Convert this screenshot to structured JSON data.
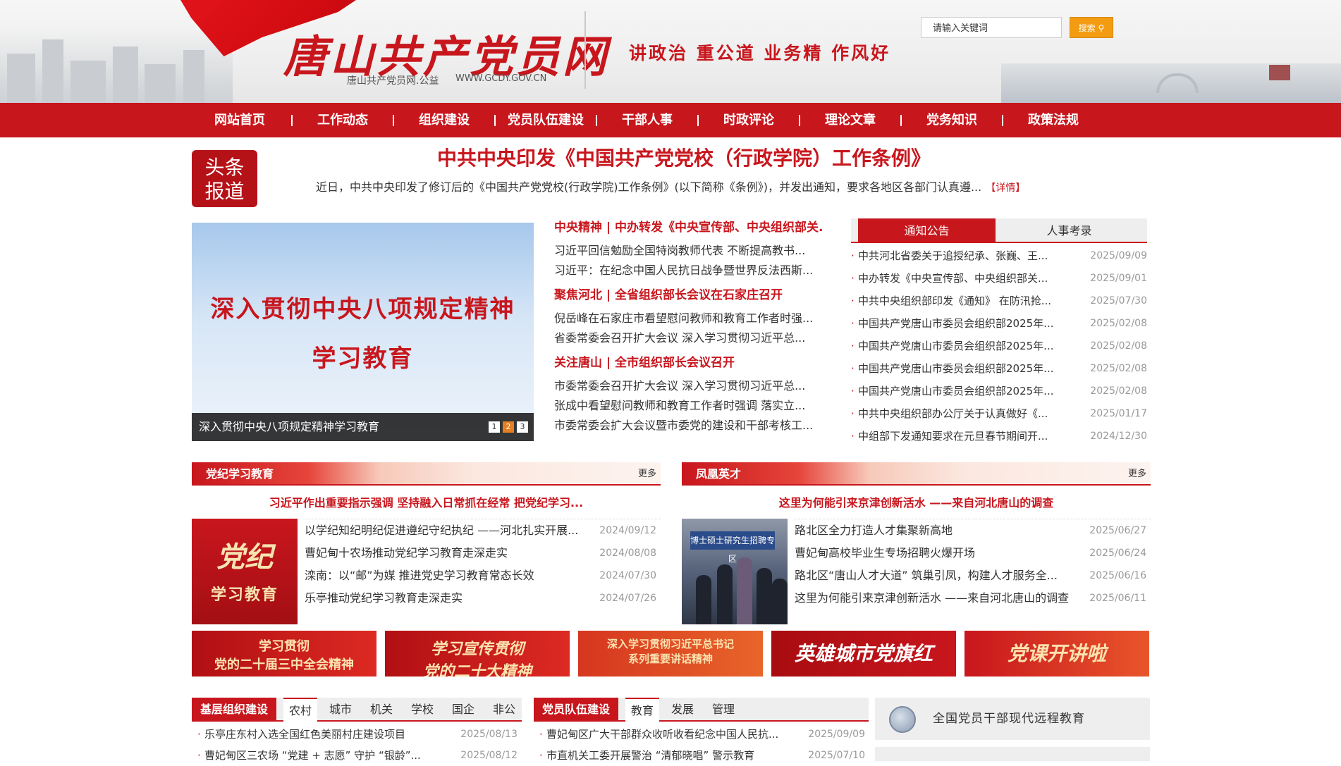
{
  "header": {
    "logo_title": "唐山共产党员网",
    "logo_sub": "唐山共产党员网.公益",
    "logo_url": "WWW.GCDY.GOV.CN",
    "slogan": "讲政治 重公道 业务精 作风好",
    "search_placeholder": "请输入关键词",
    "search_button": "搜索"
  },
  "nav": {
    "items": [
      "网站首页",
      "工作动态",
      "组织建设",
      "党员队伍建设",
      "干部人事",
      "时政评论",
      "理论文章",
      "党务知识",
      "政策法规"
    ]
  },
  "headline": {
    "badge_line1": "头条",
    "badge_line2": "报道",
    "title": "中共中央印发《中国共产党党校（行政学院）工作条例》",
    "summary": "近日，中共中央印发了修订后的《中国共产党党校(行政学院)工作条例》(以下简称《条例》)，并发出通知，要求各地区各部门认真遵...",
    "more": "【详情】"
  },
  "slideshow": {
    "line1": "深入贯彻中央八项规定精神",
    "line2": "学习教育",
    "caption": "深入贯彻中央八项规定精神学习教育",
    "dots": [
      "1",
      "2",
      "3"
    ],
    "active_dot": 2
  },
  "middle_news": [
    {
      "head": "中央精神 | 中办转发《中央宣传部、中央组织部关...",
      "items": [
        "习近平回信勉励全国特岗教师代表 不断提高教书...",
        "习近平：在纪念中国人民抗日战争暨世界反法西斯..."
      ]
    },
    {
      "head": "聚焦河北 | 全省组织部长会议在石家庄召开",
      "items": [
        "倪岳峰在石家庄市看望慰问教师和教育工作者时强...",
        "省委常委会召开扩大会议 深入学习贯彻习近平总..."
      ]
    },
    {
      "head": "关注唐山 | 全市组织部长会议召开",
      "items": [
        "市委常委会召开扩大会议 深入学习贯彻习近平总...",
        "张成中看望慰问教师和教育工作者时强调 落实立...",
        "市委常委会扩大会议暨市委党的建设和干部考核工..."
      ]
    }
  ],
  "notice": {
    "tab_active": "通知公告",
    "tab_other": "人事考录",
    "rows": [
      {
        "text": "中共河北省委关于追授纪承、张巍、王...",
        "date": "2025/09/09"
      },
      {
        "text": "中办转发《中央宣传部、中央组织部关...",
        "date": "2025/09/01"
      },
      {
        "text": "中共中央组织部印发《通知》 在防汛抢...",
        "date": "2025/07/30"
      },
      {
        "text": "中国共产党唐山市委员会组织部2025年...",
        "date": "2025/02/08"
      },
      {
        "text": "中国共产党唐山市委员会组织部2025年...",
        "date": "2025/02/08"
      },
      {
        "text": "中国共产党唐山市委员会组织部2025年...",
        "date": "2025/02/08"
      },
      {
        "text": "中国共产党唐山市委员会组织部2025年...",
        "date": "2025/02/08"
      },
      {
        "text": "中共中央组织部办公厅关于认真做好《...",
        "date": "2025/01/17"
      },
      {
        "text": "中组部下发通知要求在元旦春节期间开...",
        "date": "2024/12/30"
      }
    ]
  },
  "panel_left": {
    "title": "党纪学习教育",
    "more": "更多",
    "lead": "习近平作出重要指示强调 坚持融入日常抓在经常 把党纪学习...",
    "img_line1": "党纪",
    "img_line2": "学习教育",
    "rows": [
      {
        "text": "以学纪知纪明纪促进遵纪守纪执纪 ——河北扎实开展...",
        "date": "2024/09/12"
      },
      {
        "text": "曹妃甸十农场推动党纪学习教育走深走实",
        "date": "2024/08/08"
      },
      {
        "text": "滦南：以“邮”为媒 推进党史学习教育常态长效",
        "date": "2024/07/30"
      },
      {
        "text": "乐亭推动党纪学习教育走深走实",
        "date": "2024/07/26"
      }
    ]
  },
  "panel_right": {
    "title": "凤凰英才",
    "more": "更多",
    "lead": "这里为何能引来京津创新活水 ——来自河北唐山的调查",
    "img_sign": "博士硕士研究生招聘专区",
    "rows": [
      {
        "text": "路北区全力打造人才集聚新高地",
        "date": "2025/06/27"
      },
      {
        "text": "曹妃甸高校毕业生专场招聘火爆开场",
        "date": "2025/06/24"
      },
      {
        "text": "路北区“唐山人才大道” 筑巢引凤，构建人才服务全...",
        "date": "2025/06/16"
      },
      {
        "text": "这里为何能引来京津创新活水 ——来自河北唐山的调查",
        "date": "2025/06/11"
      }
    ]
  },
  "banners": [
    {
      "l1": "学习贯彻",
      "l2": "党的二十届三中全会精神"
    },
    {
      "l1": "学习宣传贯彻",
      "l2": "党的二十大精神"
    },
    {
      "l1": "深入学习贯彻习近平总书记",
      "l2": "系列重要讲话精神"
    },
    {
      "big": "英雄城市党旗红"
    },
    {
      "big": "党课开讲啦"
    }
  ],
  "bottom_left": {
    "label": "基层组织建设",
    "tabs": [
      "农村",
      "城市",
      "机关",
      "学校",
      "国企",
      "非公"
    ],
    "rows": [
      {
        "text": "乐亭庄东村入选全国红色美丽村庄建设项目",
        "date": "2025/08/13"
      },
      {
        "text": "曹妃甸区三农场 “党建 + 志愿” 守护 “银龄”...",
        "date": "2025/08/12"
      }
    ]
  },
  "bottom_mid": {
    "label": "党员队伍建设",
    "tabs": [
      "教育",
      "发展",
      "管理"
    ],
    "rows": [
      {
        "text": "曹妃甸区广大干部群众收听收看纪念中国人民抗...",
        "date": "2025/09/09"
      },
      {
        "text": "市直机关工委开展警治 “清郁晓唱” 警示教育",
        "date": "2025/07/10"
      }
    ]
  },
  "remote": {
    "text": "全国党员干部现代远程教育"
  }
}
